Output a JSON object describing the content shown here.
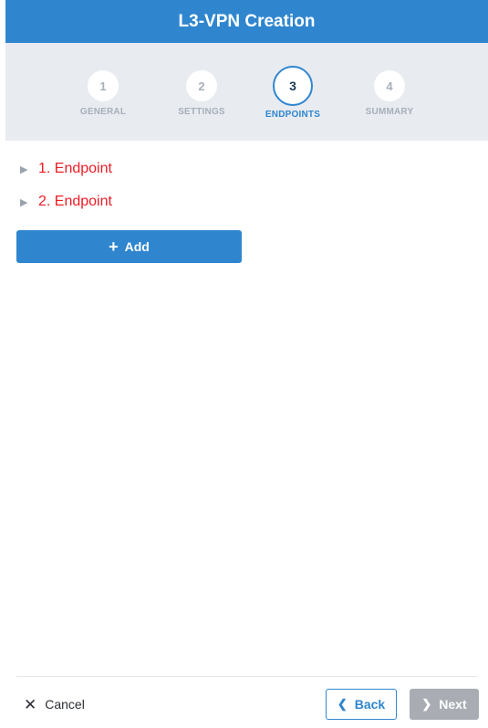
{
  "header": {
    "title": "L3-VPN Creation"
  },
  "stepper": {
    "steps": [
      {
        "number": "1",
        "label": "GENERAL"
      },
      {
        "number": "2",
        "label": "SETTINGS"
      },
      {
        "number": "3",
        "label": "ENDPOINTS"
      },
      {
        "number": "4",
        "label": "SUMMARY"
      }
    ],
    "active_step": "3"
  },
  "endpoints": [
    {
      "label": "1. Endpoint",
      "status_color": "#ee1c25",
      "icon": "caret-right-icon"
    },
    {
      "label": "2. Endpoint",
      "status_color": "#ee1c25",
      "icon": "caret-right-icon"
    }
  ],
  "add_button": {
    "label": "Add",
    "icon": "plus-icon"
  },
  "footer": {
    "cancel_label": "Cancel",
    "cancel_icon": "close-icon",
    "back_label": "Back",
    "back_icon": "chevron-left-icon",
    "next_label": "Next",
    "next_icon": "chevron-right-icon",
    "next_disabled": true
  },
  "colors": {
    "primary": "#2f86cf",
    "stepper_bg": "#e8ebf0",
    "error": "#ee1c25",
    "disabled": "#a9adb3"
  }
}
